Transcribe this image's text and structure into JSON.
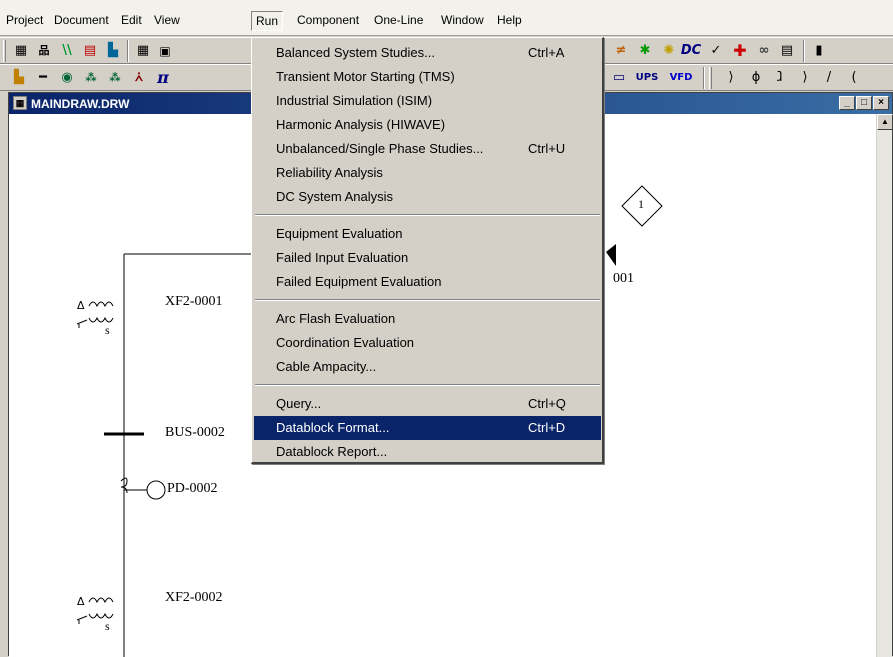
{
  "menubar": {
    "items": [
      {
        "label": "Project"
      },
      {
        "label": "Document"
      },
      {
        "label": "Edit"
      },
      {
        "label": "View"
      },
      {
        "label": "Run"
      },
      {
        "label": "Component"
      },
      {
        "label": "One-Line"
      },
      {
        "label": "Window"
      },
      {
        "label": "Help"
      }
    ],
    "active_menu": "Run"
  },
  "toolbar": {
    "dc_label": "DC",
    "ups_label": "UPS",
    "vfd_label": "VFD",
    "pi_label": "π"
  },
  "window": {
    "title": "MAINDRAW.DRW",
    "minimize": "_",
    "maximize": "□",
    "close": "×"
  },
  "drawing": {
    "labels": {
      "xf1": "XF2-0001",
      "bus": "BUS-0002",
      "pd": "PD-0002",
      "xf2": "XF2-0002",
      "node_number": "1",
      "partial_id": "001",
      "s1": "s",
      "s2": "s"
    }
  },
  "run_menu": {
    "items": [
      {
        "label": "Balanced System Studies...",
        "shortcut": "Ctrl+A"
      },
      {
        "label": "Transient Motor Starting (TMS)",
        "shortcut": ""
      },
      {
        "label": "Industrial Simulation (ISIM)",
        "shortcut": ""
      },
      {
        "label": "Harmonic Analysis (HIWAVE)",
        "shortcut": ""
      },
      {
        "label": "Unbalanced/Single Phase Studies...",
        "shortcut": "Ctrl+U"
      },
      {
        "label": "Reliability Analysis",
        "shortcut": ""
      },
      {
        "label": "DC System Analysis",
        "shortcut": ""
      },
      {
        "label": "Equipment Evaluation",
        "shortcut": ""
      },
      {
        "label": "Failed Input Evaluation",
        "shortcut": ""
      },
      {
        "label": "Failed Equipment Evaluation",
        "shortcut": ""
      },
      {
        "label": "Arc Flash Evaluation",
        "shortcut": ""
      },
      {
        "label": "Coordination Evaluation",
        "shortcut": ""
      },
      {
        "label": "Cable Ampacity...",
        "shortcut": ""
      },
      {
        "label": "Query...",
        "shortcut": "Ctrl+Q"
      },
      {
        "label": "Datablock Format...",
        "shortcut": "Ctrl+D"
      },
      {
        "label": "Datablock Report...",
        "shortcut": ""
      }
    ],
    "highlighted": "Datablock Format..."
  },
  "colors": {
    "menu_highlight": "#0a246a",
    "title_bar": "#0a246a",
    "chrome": "#d4d0c8"
  }
}
